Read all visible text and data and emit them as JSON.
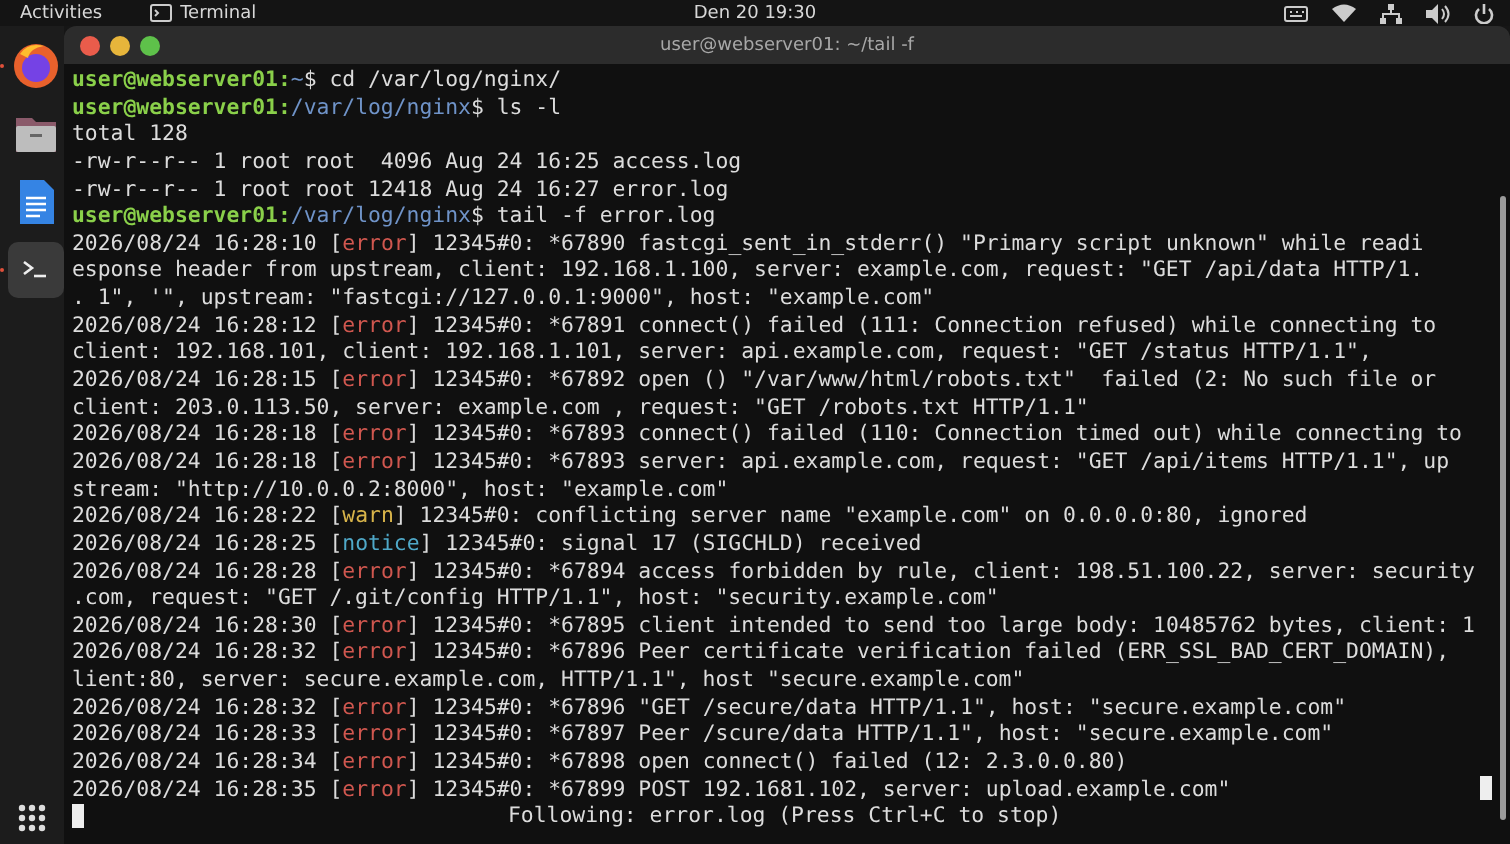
{
  "top_bar": {
    "activities": "Activities",
    "app_name": "Terminal",
    "clock": "Den 20  19:30"
  },
  "dock": {
    "items": [
      {
        "kind": "browser",
        "running": true,
        "selected": false
      },
      {
        "kind": "files",
        "running": false,
        "selected": false
      },
      {
        "kind": "document",
        "running": false,
        "selected": false
      },
      {
        "kind": "terminal",
        "running": true,
        "selected": true
      }
    ]
  },
  "window": {
    "title": "user@webserver01: ~/tail -f"
  },
  "terminal": {
    "lines": [
      {
        "kind": "prompt",
        "user": "user@webserver01:",
        "path": "~",
        "command": "$ cd /var/log/nginx/"
      },
      {
        "kind": "prompt",
        "user": "user@webserver01:",
        "path": "/var/log/nginx",
        "command": "$ ls -l"
      },
      {
        "kind": "output",
        "text": "total 128"
      },
      {
        "kind": "output",
        "text": "-rw-r--r-- 1 root root  4096 Aug 24 16:25 access.log"
      },
      {
        "kind": "output",
        "text": "-rw-r--r-- 1 root root 12418 Aug 24 16:27 error.log"
      },
      {
        "kind": "prompt",
        "user": "user@webserver01:",
        "path": "/var/log/nginx",
        "command": "$ tail -f error.log"
      },
      {
        "kind": "log",
        "time": "2026/08/24 16:28:10 ",
        "open": "[",
        "tag": "error",
        "close": "]",
        "color": "#d0574f",
        "text": " 12345#0: *67890 fastcgi_sent_in_stderr() \"Primary script unknown\" while readi"
      },
      {
        "kind": "output",
        "text": "esponse header from upstream, client: 192.168.1.100, server: example.com, request: \"GET /api/data HTTP/1."
      },
      {
        "kind": "output",
        "text": ". 1\", '\", upstream: \"fastcgi://127.0.0.1:9000\", host: \"example.com\""
      },
      {
        "kind": "log",
        "time": "2026/08/24 16:28:12 ",
        "open": "[",
        "tag": "error",
        "close": "]",
        "color": "#d0574f",
        "text": " 12345#0: *67891 connect() failed (111: Connection refused) while connecting to"
      },
      {
        "kind": "output",
        "text": "client: 192.168.101, client: 192.168.1.101, server: api.example.com, request: \"GET /status HTTP/1.1\","
      },
      {
        "kind": "log",
        "time": "2026/08/24 16:28:15 ",
        "open": "[",
        "tag": "error",
        "close": "]",
        "color": "#d0574f",
        "text": " 12345#0: *67892 open () \"/var/www/html/robots.txt\"  failed (2: No such file or"
      },
      {
        "kind": "output",
        "text": "client: 203.0.113.50, server: example.com , request: \"GET /robots.txt HTTP/1.1\""
      },
      {
        "kind": "log",
        "time": "2026/08/24 16:28:18 ",
        "open": "[",
        "tag": "error",
        "close": "]",
        "color": "#d0574f",
        "text": " 12345#0: *67893 connect() failed (110: Connection timed out) while connecting to"
      },
      {
        "kind": "log",
        "time": "2026/08/24 16:28:18 ",
        "open": "[",
        "tag": "error",
        "close": "]",
        "color": "#d0574f",
        "text": " 12345#0: *67893 server: api.example.com, request: \"GET /api/items HTTP/1.1\", up"
      },
      {
        "kind": "output",
        "text": "stream: \"http://10.0.0.2:8000\", host: \"example.com\""
      },
      {
        "kind": "log",
        "time": "2026/08/24 16:28:22 ",
        "open": "[",
        "tag": "warn",
        "close": "]",
        "color": "#d8b44a",
        "text": " 12345#0: conflicting server name \"example.com\" on 0.0.0.0:80, ignored"
      },
      {
        "kind": "log",
        "time": "2026/08/24 16:28:25 ",
        "open": "[",
        "tag": "notice",
        "close": "]",
        "color": "#4fa8c8",
        "text": " 12345#0: signal 17 (SIGCHLD) received"
      },
      {
        "kind": "log",
        "time": "2026/08/24 16:28:28 ",
        "open": "[",
        "tag": "error",
        "close": "]",
        "color": "#d0574f",
        "text": " 12345#0: *67894 access forbidden by rule, client: 198.51.100.22, server: security"
      },
      {
        "kind": "output",
        "text": ".com, request: \"GET /.git/config HTTP/1.1\", host: \"security.example.com\""
      },
      {
        "kind": "log",
        "time": "2026/08/24 16:28:30 ",
        "open": "[",
        "tag": "error",
        "close": "]",
        "color": "#d0574f",
        "text": " 12345#0: *67895 client intended to send too large body: 10485762 bytes, client: 1"
      },
      {
        "kind": "log",
        "time": "2026/08/24 16:28:32 ",
        "open": "[",
        "tag": "error",
        "close": "]",
        "color": "#d0574f",
        "text": " 12345#0: *67896 Peer certificate verification failed (ERR_SSL_BAD_CERT_DOMAIN),"
      },
      {
        "kind": "output",
        "text": "lient:80, server: secure.example.com, HTTP/1.1\", host \"secure.example.com\""
      },
      {
        "kind": "log",
        "time": "2026/08/24 16:28:32 ",
        "open": "[",
        "tag": "error",
        "close": "]",
        "color": "#d0574f",
        "text": " 12345#0: *67896 \"GET /secure/data HTTP/1.1\", host: \"secure.example.com\""
      },
      {
        "kind": "log",
        "time": "2026/08/24 16:28:33 ",
        "open": "[",
        "tag": "error",
        "close": "]",
        "color": "#d0574f",
        "text": " 12345#0: *67897 Peer /scure/data HTTP/1.1\", host: \"secure.example.com\""
      },
      {
        "kind": "log",
        "time": "2026/08/24 16:28:34 ",
        "open": "[",
        "tag": "error",
        "close": "]",
        "color": "#d0574f",
        "text": " 12345#0: *67898 open connect() failed (12: 2.3.0.0.80)"
      },
      {
        "kind": "log",
        "time": "2026/08/24 16:28:35 ",
        "open": "[",
        "tag": "error",
        "close": "]",
        "color": "#d0574f",
        "text": " 12345#0: *67899 POST 192.1681.102, server: upload.example.com\""
      }
    ],
    "status": "Following: error.log (Press Ctrl+C to stop)"
  }
}
